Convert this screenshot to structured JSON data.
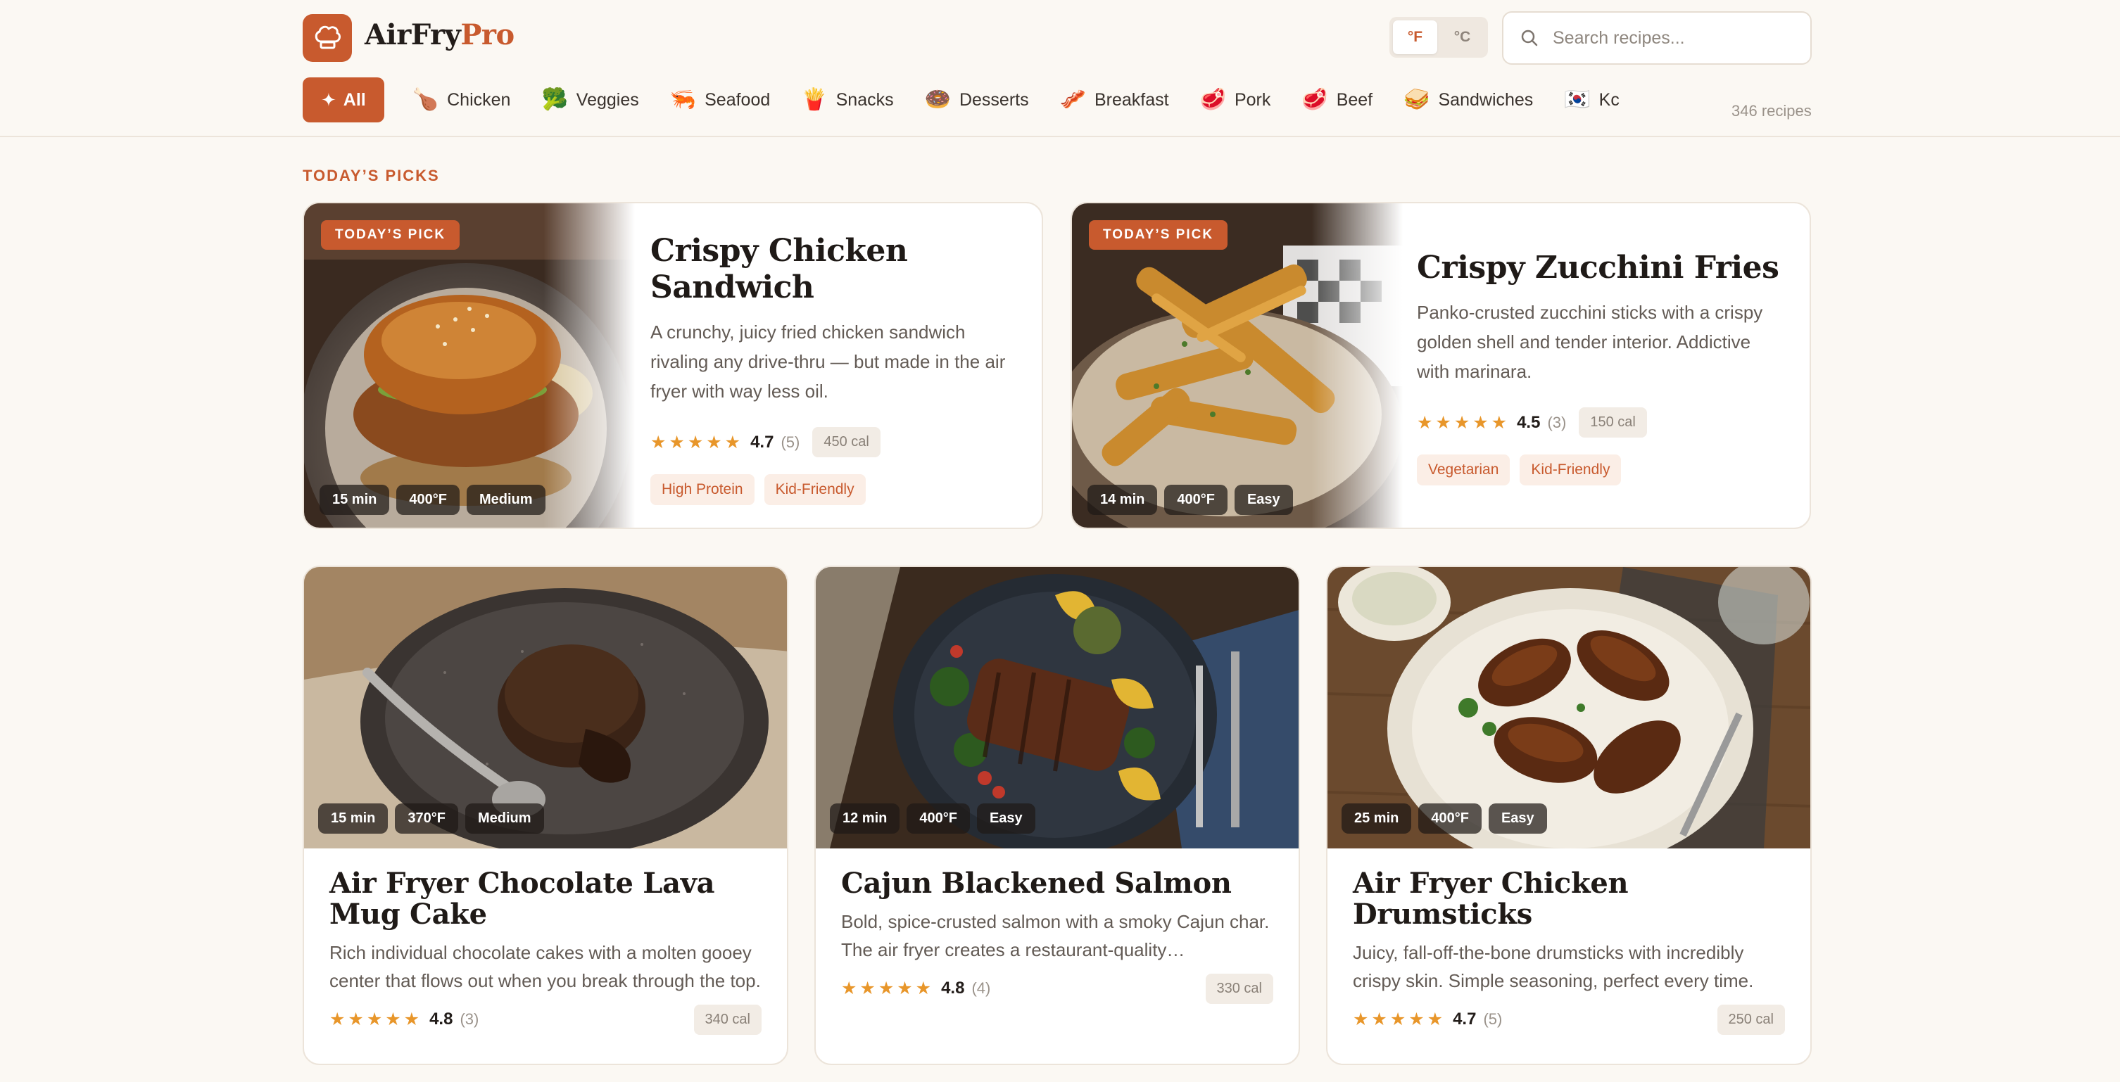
{
  "header": {
    "brand_part1": "AirFry",
    "brand_part2": "Pro",
    "unit_f": "°F",
    "unit_c": "°C",
    "search_placeholder": "Search recipes...",
    "recipe_count": "346 recipes"
  },
  "categories": [
    {
      "icon": "✦",
      "label": "All",
      "active": true
    },
    {
      "icon": "🍗",
      "label": "Chicken"
    },
    {
      "icon": "🥦",
      "label": "Veggies"
    },
    {
      "icon": "🦐",
      "label": "Seafood"
    },
    {
      "icon": "🍟",
      "label": "Snacks"
    },
    {
      "icon": "🍩",
      "label": "Desserts"
    },
    {
      "icon": "🥓",
      "label": "Breakfast"
    },
    {
      "icon": "🥩",
      "label": "Pork"
    },
    {
      "icon": "🥩",
      "label": "Beef"
    },
    {
      "icon": "🥪",
      "label": "Sandwiches"
    },
    {
      "icon": "🇰🇷",
      "label": "Kc"
    }
  ],
  "section_label": "TODAY’S PICKS",
  "featured": [
    {
      "badge": "TODAY’S PICK",
      "title": "Crispy Chicken Sandwich",
      "description": "A crunchy, juicy fried chicken sandwich rivaling any drive-thru — but made in the air fryer with way less oil.",
      "stars": "★★★★★",
      "rating": "4.7",
      "reviews": "(5)",
      "calories": "450 cal",
      "chips": [
        "15 min",
        "400°F",
        "Medium"
      ],
      "tags": [
        "High Protein",
        "Kid-Friendly"
      ]
    },
    {
      "badge": "TODAY’S PICK",
      "title": "Crispy Zucchini Fries",
      "description": "Panko-crusted zucchini sticks with a crispy golden shell and tender interior. Addictive with marinara.",
      "stars": "★★★★★",
      "rating": "4.5",
      "reviews": "(3)",
      "calories": "150 cal",
      "chips": [
        "14 min",
        "400°F",
        "Easy"
      ],
      "tags": [
        "Vegetarian",
        "Kid-Friendly"
      ]
    }
  ],
  "recipes": [
    {
      "title": "Air Fryer Chocolate Lava Mug Cake",
      "description": "Rich individual chocolate cakes with a molten gooey center that flows out when you break through the top.",
      "stars": "★★★★★",
      "rating": "4.8",
      "reviews": "(3)",
      "calories": "340 cal",
      "chips": [
        "15 min",
        "370°F",
        "Medium"
      ]
    },
    {
      "title": "Cajun Blackened Salmon",
      "description": "Bold, spice-crusted salmon with a smoky Cajun char. The air fryer creates a restaurant-quality blackened…",
      "stars": "★★★★★",
      "rating": "4.8",
      "reviews": "(4)",
      "calories": "330 cal",
      "chips": [
        "12 min",
        "400°F",
        "Easy"
      ]
    },
    {
      "title": "Air Fryer Chicken Drumsticks",
      "description": "Juicy, fall-off-the-bone drumsticks with incredibly crispy skin. Simple seasoning, perfect every time.",
      "stars": "★★★★★",
      "rating": "4.7",
      "reviews": "(5)",
      "calories": "250 cal",
      "chips": [
        "25 min",
        "400°F",
        "Easy"
      ]
    }
  ],
  "colors": {
    "accent": "#c85a2e",
    "background": "#fbf8f3",
    "star": "#e8962a"
  }
}
